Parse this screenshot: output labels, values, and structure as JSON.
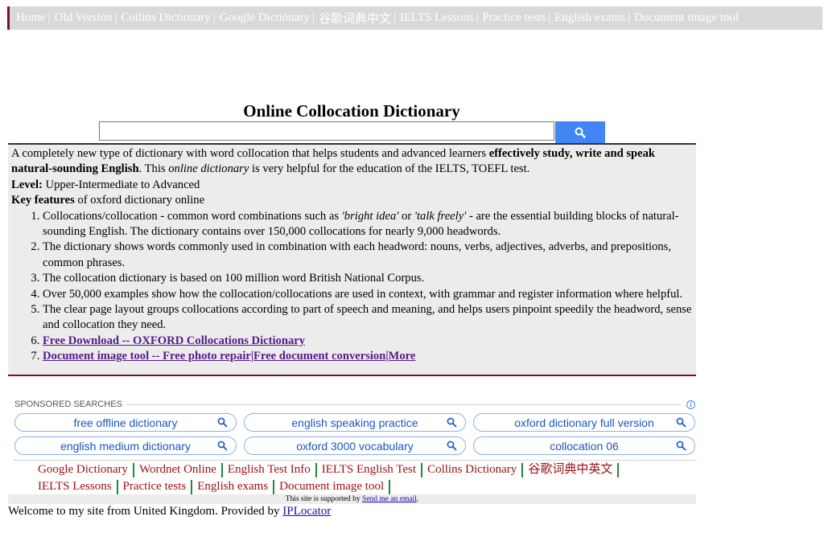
{
  "topnav": {
    "items": [
      "Home",
      "Old Version",
      "Collins Dictionary",
      "Google Dictionary",
      "谷歌词典中文",
      "IELTS Lessons",
      "Practice tests",
      "English exams",
      "Document image tool"
    ]
  },
  "page": {
    "title": "Online Collocation Dictionary"
  },
  "search": {
    "value": "",
    "icon": "search-icon"
  },
  "info": {
    "intro_1": "A completely new type of dictionary with word collocation that helps students and advanced learners ",
    "intro_bold": "effectively study, write and speak natural-sounding English",
    "intro_2": ". This ",
    "intro_em": "online dictionary",
    "intro_3": " is very helpful for the education of the IELTS, TOEFL test.",
    "level_label": "Level:",
    "level_value": " Upper-Intermediate to Advanced",
    "features_label": "Key features",
    "features_rest": " of oxford dictionary online",
    "item1_a": "Collocations/collocation - common word combinations such as ",
    "item1_em1": "'bright idea'",
    "item1_b": " or ",
    "item1_em2": "'talk freely'",
    "item1_c": " - are the essential building blocks of natural-sounding English. The dictionary contains over 150,000 collocations for nearly 9,000 headwords.",
    "item2": "The dictionary shows words commonly used in combination with each headword: nouns, verbs, adjectives, adverbs, and prepositions, common phrases.",
    "item3": "The collocation dictionary is based on 100 million word British National Corpus.",
    "item4": "Over 50,000 examples show how the collocation/collocations are used in context, with grammar and register information where helpful.",
    "item5": "The clear page layout groups collocations according to part of speech and meaning, and helps users pinpoint speedily the headword, sense and collocation they need.",
    "item6_link": "Free Download -- OXFORD Collocations Dictionary",
    "item7_link": "Document image tool -- Free photo repair|Free document conversion|More"
  },
  "sponsored": {
    "heading": "SPONSORED SEARCHES",
    "items": [
      "free offline dictionary",
      "english speaking practice",
      "oxford dictionary full version",
      "english medium dictionary",
      "oxford 3000 vocabulary",
      "collocation 06"
    ]
  },
  "bottom_links": [
    "Google Dictionary",
    "Wordnet Online",
    "English Test Info",
    "IELTS English Test",
    "Collins Dictionary",
    "谷歌词典中英文",
    "IELTS Lessons",
    "Practice tests",
    "English exams",
    "Document image tool"
  ],
  "support": {
    "text": "This site is supported by ",
    "link": "Send me an email",
    "end": "."
  },
  "welcome": {
    "text": "Welcome to my site from United Kingdom. Provided by ",
    "link": "IPLocator"
  },
  "colors": {
    "accent": "#4285f4",
    "nav_bg": "#d9d9d9",
    "link_red": "#9b0f13",
    "separator_green": "#1f8a3a"
  }
}
